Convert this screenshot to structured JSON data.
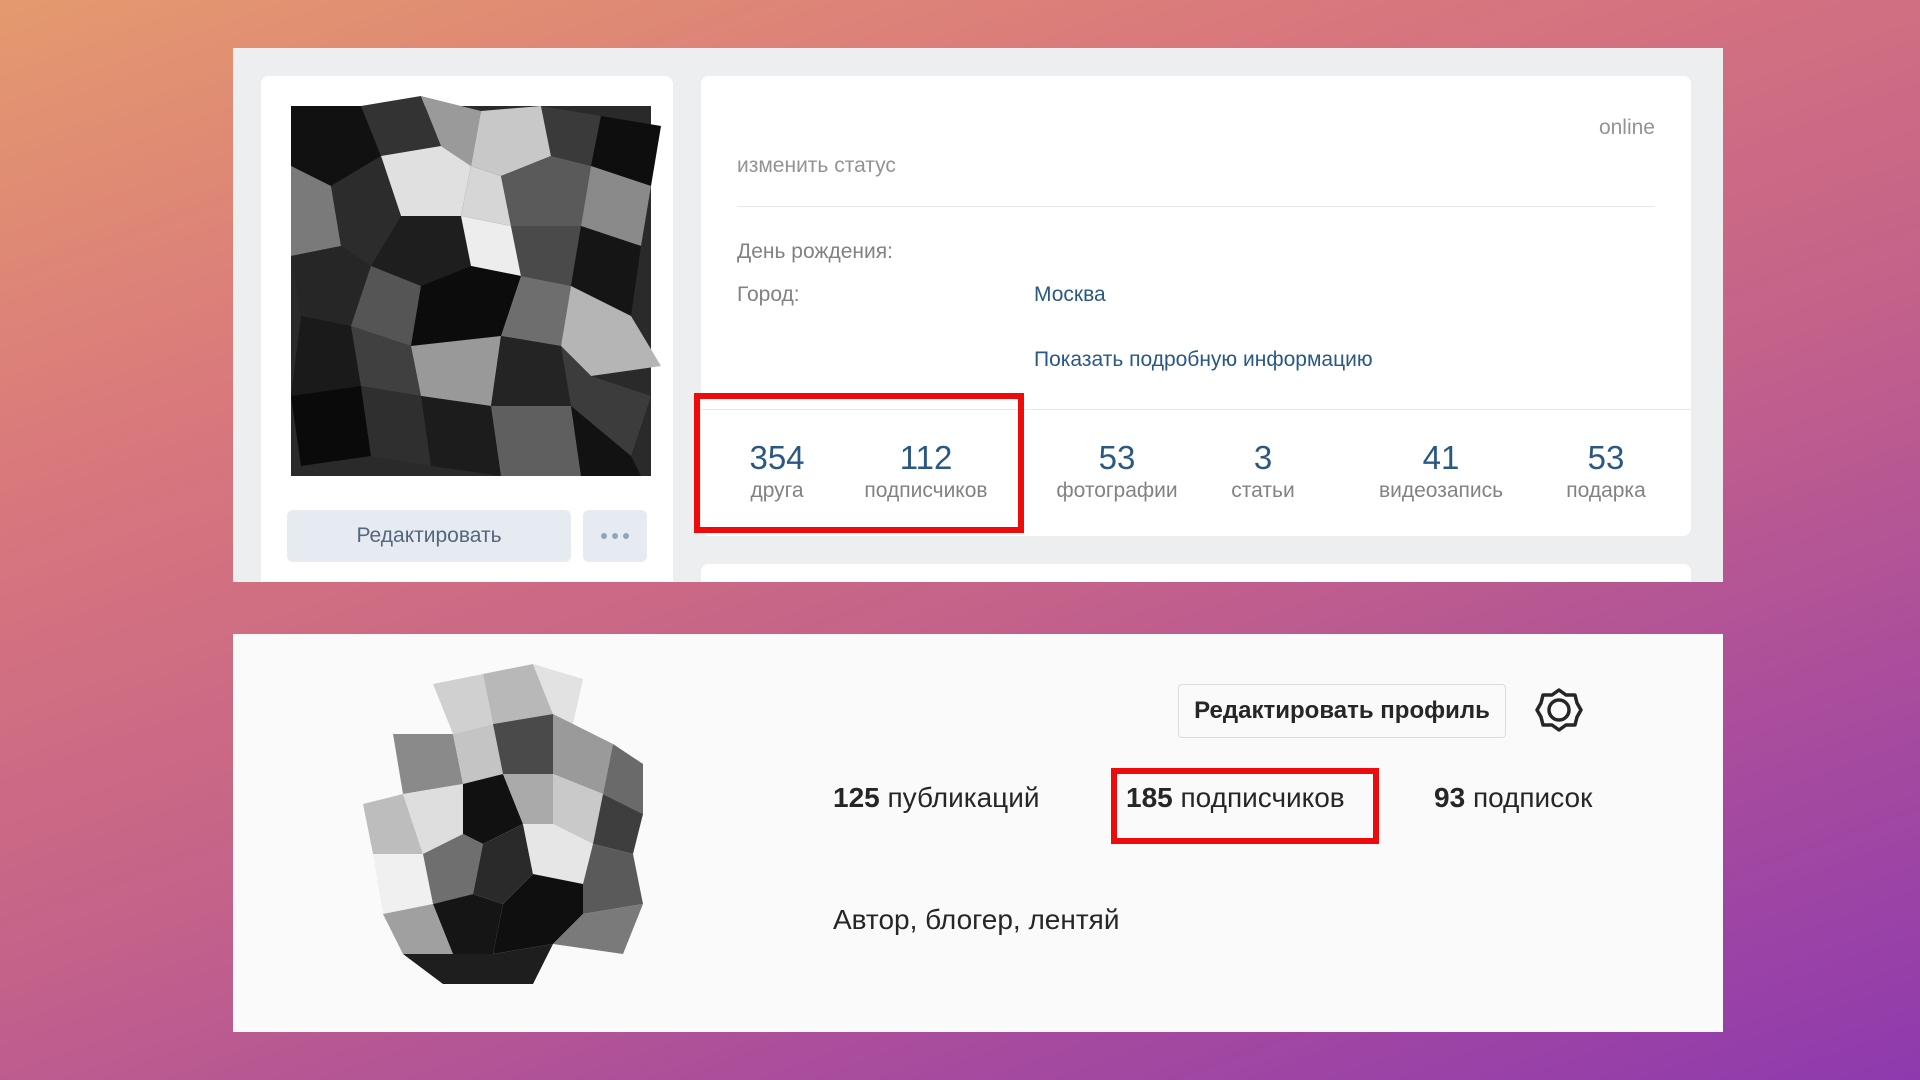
{
  "vk": {
    "status_link": "изменить статус",
    "online": "online",
    "birthday_label": "День рождения:",
    "city_label": "Город:",
    "city_value": "Москва",
    "show_more": "Показать подробную информацию",
    "edit_button": "Редактировать",
    "counters": [
      {
        "number": "354",
        "label": "друга"
      },
      {
        "number": "112",
        "label": "подписчиков"
      },
      {
        "number": "53",
        "label": "фотографии"
      },
      {
        "number": "3",
        "label": "статьи"
      },
      {
        "number": "41",
        "label": "видеозапись"
      },
      {
        "number": "53",
        "label": "подарка"
      }
    ]
  },
  "instagram": {
    "edit_profile_button": "Редактировать профиль",
    "stats": [
      {
        "number": "125",
        "label": "публикаций"
      },
      {
        "number": "185",
        "label": "подписчиков"
      },
      {
        "number": "93",
        "label": "подписок"
      }
    ],
    "bio": "Автор, блогер, лентяй"
  },
  "colors": {
    "highlight": "#ee0b0b",
    "vk_link": "#2a5885",
    "vk_muted": "#828282"
  }
}
